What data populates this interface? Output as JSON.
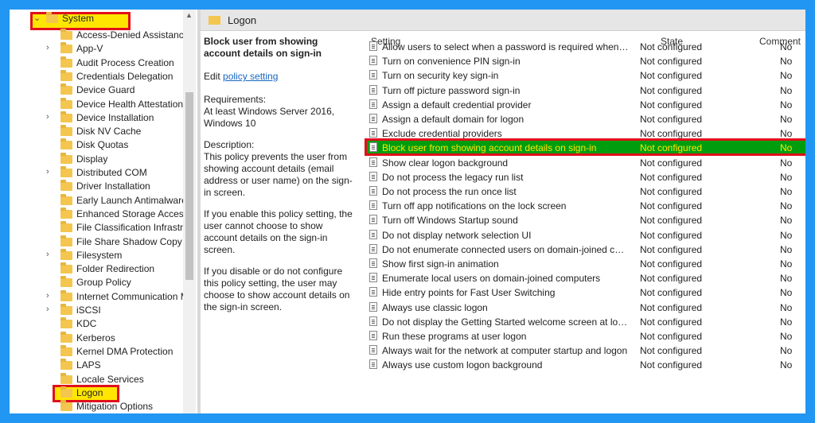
{
  "tree": {
    "root_label": "System",
    "selected_label": "Logon",
    "items": [
      {
        "label": "Access-Denied Assistance",
        "expandable": false
      },
      {
        "label": "App-V",
        "expandable": true
      },
      {
        "label": "Audit Process Creation",
        "expandable": false
      },
      {
        "label": "Credentials Delegation",
        "expandable": false
      },
      {
        "label": "Device Guard",
        "expandable": false
      },
      {
        "label": "Device Health Attestation S",
        "expandable": false
      },
      {
        "label": "Device Installation",
        "expandable": true
      },
      {
        "label": "Disk NV Cache",
        "expandable": false
      },
      {
        "label": "Disk Quotas",
        "expandable": false
      },
      {
        "label": "Display",
        "expandable": false
      },
      {
        "label": "Distributed COM",
        "expandable": true
      },
      {
        "label": "Driver Installation",
        "expandable": false
      },
      {
        "label": "Early Launch Antimalware",
        "expandable": false
      },
      {
        "label": "Enhanced Storage Access",
        "expandable": false
      },
      {
        "label": "File Classification Infrastru",
        "expandable": false
      },
      {
        "label": "File Share Shadow Copy Pr",
        "expandable": false
      },
      {
        "label": "Filesystem",
        "expandable": true
      },
      {
        "label": "Folder Redirection",
        "expandable": false
      },
      {
        "label": "Group Policy",
        "expandable": false
      },
      {
        "label": "Internet Communication M",
        "expandable": true
      },
      {
        "label": "iSCSI",
        "expandable": true
      },
      {
        "label": "KDC",
        "expandable": false
      },
      {
        "label": "Kerberos",
        "expandable": false
      },
      {
        "label": "Kernel DMA Protection",
        "expandable": false
      },
      {
        "label": "LAPS",
        "expandable": false
      },
      {
        "label": "Locale Services",
        "expandable": false
      },
      {
        "label": "Logon",
        "expandable": false
      },
      {
        "label": "Mitigation Options",
        "expandable": false
      }
    ]
  },
  "header": {
    "title": "Logon"
  },
  "description": {
    "title": "Block user from showing account details on sign-in",
    "edit_prefix": "Edit ",
    "edit_link": "policy setting",
    "requirements_label": "Requirements:",
    "requirements_text": "At least Windows Server 2016, Windows 10",
    "description_label": "Description:",
    "para1": "This policy prevents the user from showing account details (email address or user name) on the sign-in screen.",
    "para2": "If you enable this policy setting, the user cannot choose to show account details on the sign-in screen.",
    "para3": "If you disable or do not configure this policy setting, the user may choose to show account details on the sign-in screen."
  },
  "table": {
    "columns": {
      "setting": "Setting",
      "state": "State",
      "comment": "Comment"
    },
    "rows": [
      {
        "setting": "Allow users to select when a password is required when resu...",
        "state": "Not configured",
        "comment": "No"
      },
      {
        "setting": "Turn on convenience PIN sign-in",
        "state": "Not configured",
        "comment": "No"
      },
      {
        "setting": "Turn on security key sign-in",
        "state": "Not configured",
        "comment": "No"
      },
      {
        "setting": "Turn off picture password sign-in",
        "state": "Not configured",
        "comment": "No"
      },
      {
        "setting": "Assign a default credential provider",
        "state": "Not configured",
        "comment": "No"
      },
      {
        "setting": "Assign a default domain for logon",
        "state": "Not configured",
        "comment": "No"
      },
      {
        "setting": "Exclude credential providers",
        "state": "Not configured",
        "comment": "No"
      },
      {
        "setting": "Block user from showing account details on sign-in",
        "state": "Not configured",
        "comment": "No",
        "selected": true
      },
      {
        "setting": "Show clear logon background",
        "state": "Not configured",
        "comment": "No"
      },
      {
        "setting": "Do not process the legacy run list",
        "state": "Not configured",
        "comment": "No"
      },
      {
        "setting": "Do not process the run once list",
        "state": "Not configured",
        "comment": "No"
      },
      {
        "setting": "Turn off app notifications on the lock screen",
        "state": "Not configured",
        "comment": "No"
      },
      {
        "setting": "Turn off Windows Startup sound",
        "state": "Not configured",
        "comment": "No"
      },
      {
        "setting": "Do not display network selection UI",
        "state": "Not configured",
        "comment": "No"
      },
      {
        "setting": "Do not enumerate connected users on domain-joined comp...",
        "state": "Not configured",
        "comment": "No"
      },
      {
        "setting": "Show first sign-in animation",
        "state": "Not configured",
        "comment": "No"
      },
      {
        "setting": "Enumerate local users on domain-joined computers",
        "state": "Not configured",
        "comment": "No"
      },
      {
        "setting": "Hide entry points for Fast User Switching",
        "state": "Not configured",
        "comment": "No"
      },
      {
        "setting": "Always use classic logon",
        "state": "Not configured",
        "comment": "No"
      },
      {
        "setting": "Do not display the Getting Started welcome screen at logon",
        "state": "Not configured",
        "comment": "No"
      },
      {
        "setting": "Run these programs at user logon",
        "state": "Not configured",
        "comment": "No"
      },
      {
        "setting": "Always wait for the network at computer startup and logon",
        "state": "Not configured",
        "comment": "No"
      },
      {
        "setting": "Always use custom logon background",
        "state": "Not configured",
        "comment": "No"
      }
    ]
  },
  "colors": {
    "frame": "#2196f3",
    "highlight": "#ffe600",
    "border": "#e0101c",
    "selected_row": "#009e0f"
  }
}
